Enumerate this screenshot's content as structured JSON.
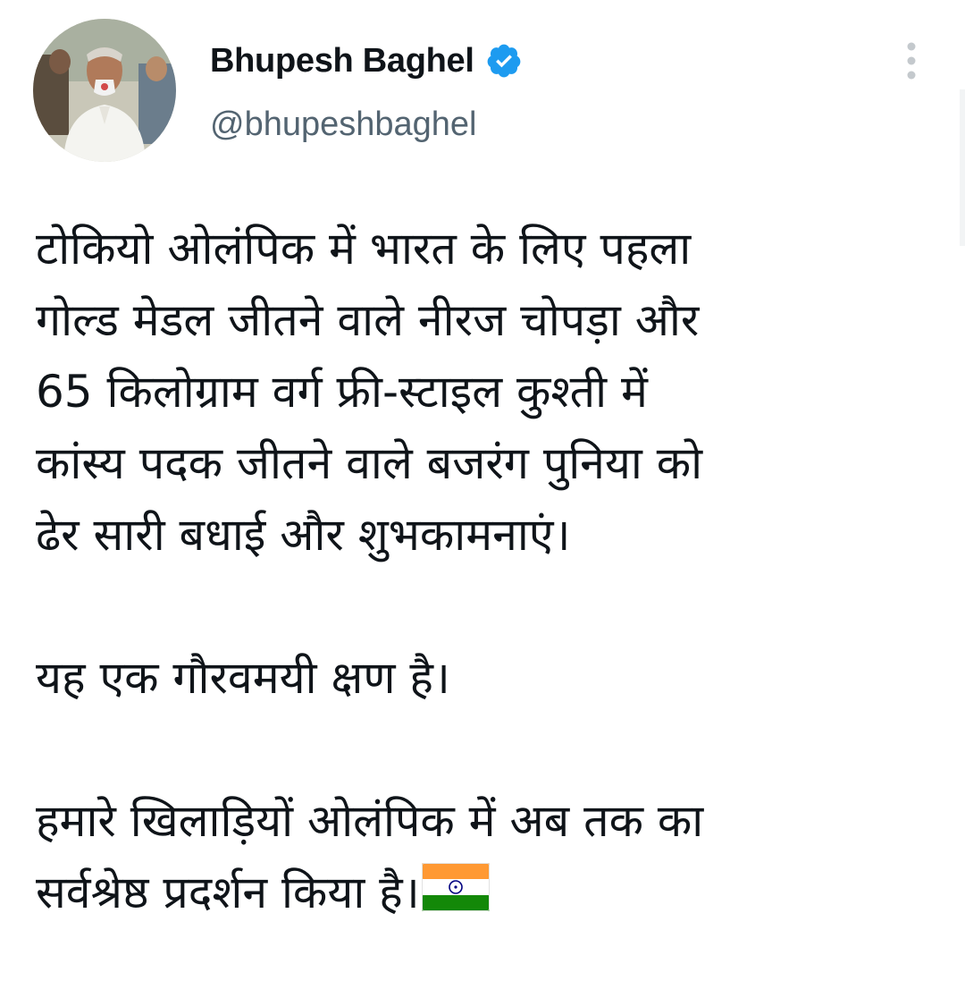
{
  "tweet": {
    "display_name": "Bhupesh Baghel",
    "handle": "@bhupeshbaghel",
    "verified_icon": "verified-badge-icon",
    "more_icon": "more-vertical-icon",
    "avatar_icon": "profile-photo",
    "paragraphs": [
      [
        "टोकियो ओलंपिक में भारत के लिए पहला",
        "गोल्ड मेडल जीतने वाले नीरज चोपड़ा और",
        "65 किलोग्राम वर्ग फ्री-स्टाइल कुश्ती में",
        "कांस्य पदक जीतने वाले बजरंग पुनिया को",
        "ढेर सारी बधाई और शुभकामनाएं।"
      ],
      [
        "यह एक गौरवमयी क्षण है।"
      ],
      [
        "हमारे खिलाड़ियों ओलंपिक में अब तक का",
        "सर्वश्रेष्ठ प्रदर्शन किया है।"
      ]
    ],
    "flag_icon": "india-flag-icon"
  },
  "colors": {
    "text": "#0f1419",
    "secondary_text": "#536471",
    "verified_blue": "#1d9bf0",
    "flag_saffron": "#ff9933",
    "flag_white": "#ffffff",
    "flag_green": "#138808",
    "chakra_navy": "#000080"
  }
}
